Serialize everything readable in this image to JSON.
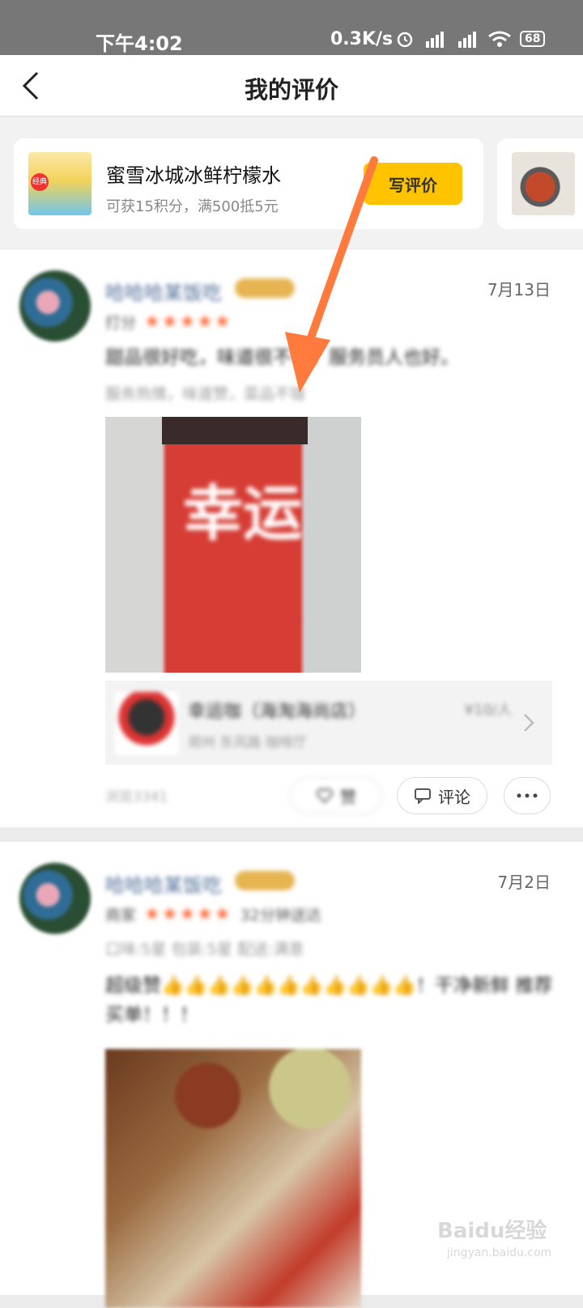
{
  "status_bar": {
    "time": "下午4:02",
    "speed": "0.3K/s",
    "battery": "68",
    "icons": [
      "alarm-icon",
      "hd-signal-icon",
      "hd-signal-icon",
      "wifi-icon",
      "battery-icon"
    ]
  },
  "nav": {
    "title": "我的评价",
    "back_icon": "chevron-left-icon"
  },
  "pending": {
    "title": "蜜雪冰城冰鲜柠檬水",
    "subtitle": "可获15积分，满500抵5元",
    "write_label": "写评价",
    "thumb_badge": "经典"
  },
  "reviews": [
    {
      "user": "哈哈哈某饭吃",
      "date": "7月13日",
      "rating_label": "打分",
      "stars": "★★★★★",
      "text": "甜品很好吃，味道很不错，服务员人也好。",
      "tags": "服务热情，味道赞，菜品不错",
      "photo_text": "幸运",
      "shop_name": "幸运咖（海淘海尚店）",
      "shop_sub": "郑州 东风路 咖啡厅",
      "shop_price": "¥10/人",
      "views": "浏览3341",
      "like_label": "赞",
      "comment_label": "评论"
    },
    {
      "user": "哈哈哈某饭吃",
      "date": "7月2日",
      "rating_label": "商家",
      "stars": "★★★★★",
      "extra": "32分钟送达",
      "tags": "口味:5星  包装:5星  配送:满意",
      "text": "超级赞👍👍👍👍👍👍👍👍👍👍👍！干净新鲜 推荐买单！！！"
    }
  ],
  "watermark": {
    "title": "Baidu经验",
    "subtitle": "jingyan.baidu.com"
  },
  "colors": {
    "accent_yellow": "#ffc300",
    "star_orange": "#ff6633",
    "arrow": "#ff7a3d"
  }
}
